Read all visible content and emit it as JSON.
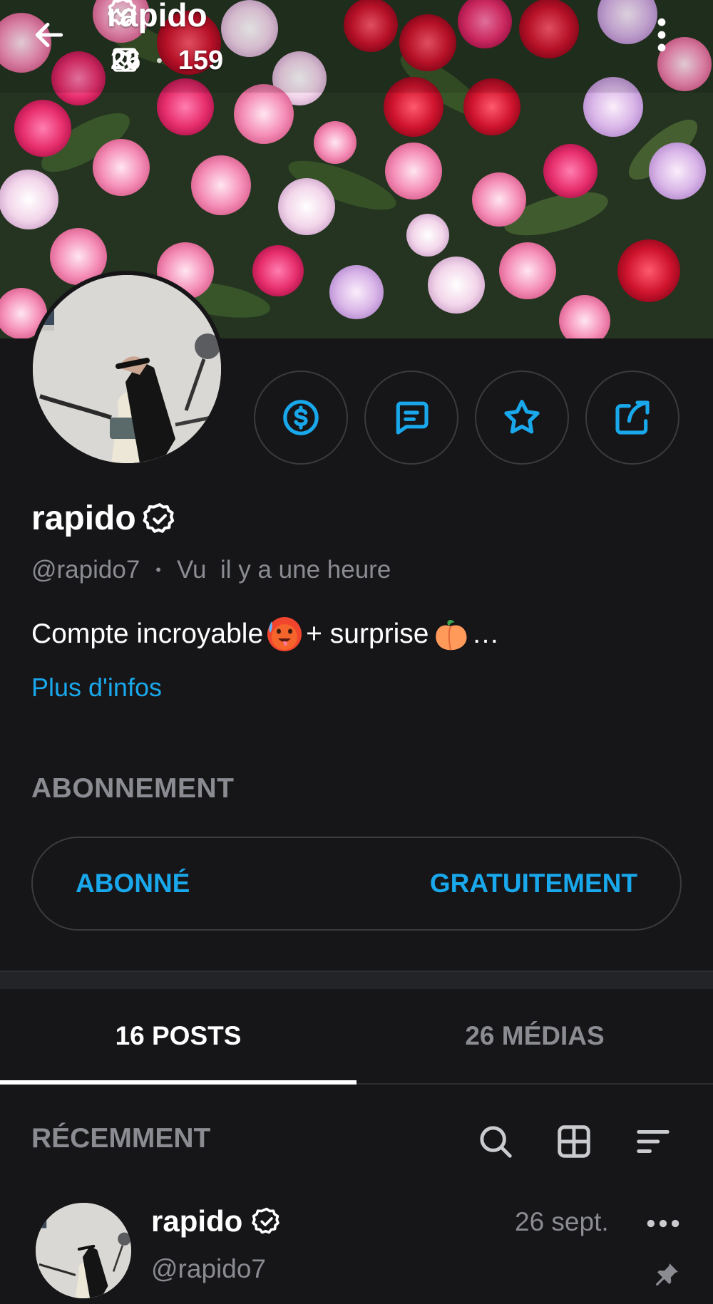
{
  "topbar": {
    "title": "rapido",
    "media_count": "26",
    "likes_count": "159"
  },
  "profile": {
    "name": "rapido",
    "handle": "@rapido7",
    "last_seen": "Vu  il y a une heure",
    "bio_part1": "Compte incroyable",
    "bio_part2": "+ surprise",
    "bio_ellipsis": "…",
    "more_info": "Plus d'infos"
  },
  "subscription": {
    "section_title": "ABONNEMENT",
    "status": "ABONNÉ",
    "price": "GRATUITEMENT"
  },
  "tabs": [
    {
      "label": "16 POSTS"
    },
    {
      "label": "26 MÉDIAS"
    }
  ],
  "feed": {
    "sort_label": "RÉCEMMENT"
  },
  "post": {
    "name": "rapido",
    "handle": "@rapido7",
    "date": "26 sept."
  },
  "colors": {
    "accent": "#1aa8ec",
    "background": "#161618",
    "muted": "#8a8c92"
  }
}
